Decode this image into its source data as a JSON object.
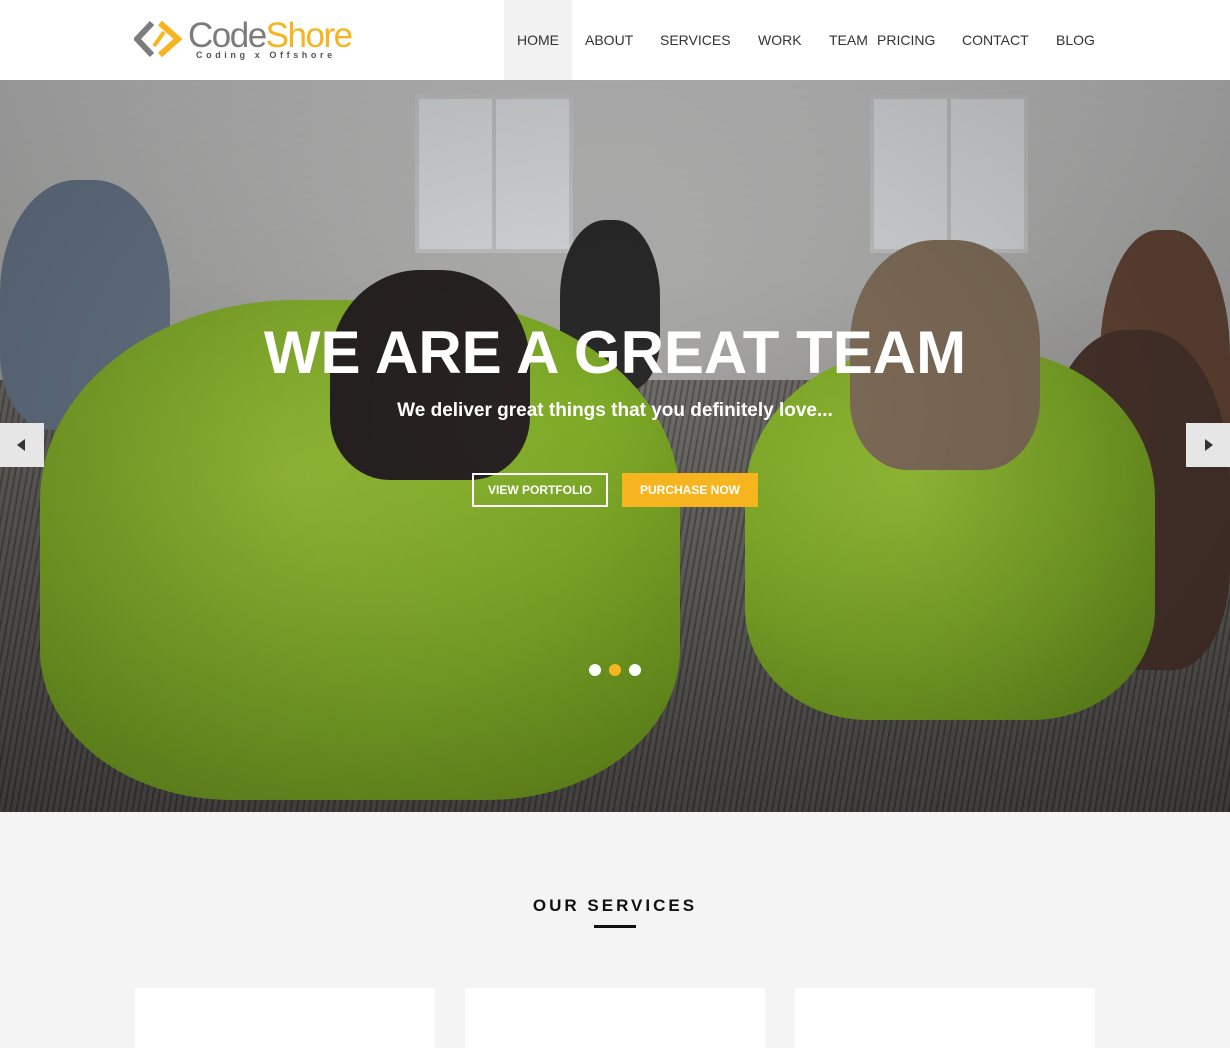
{
  "logo": {
    "word_part1": "Code",
    "word_part2": "Shore",
    "tagline": "Coding x Offshore",
    "icon": "code-brackets-icon"
  },
  "nav": {
    "items": [
      {
        "label": "HOME",
        "active": true
      },
      {
        "label": "ABOUT"
      },
      {
        "label": "SERVICES"
      },
      {
        "label": "WORK"
      },
      {
        "label": "TEAM"
      },
      {
        "label": "PRICING"
      },
      {
        "label": "CONTACT"
      },
      {
        "label": "BLOG"
      }
    ]
  },
  "hero": {
    "title": "WE ARE A GREAT TEAM",
    "subtitle": "We deliver great things that you definitely love...",
    "btn_portfolio": "VIEW PORTFOLIO",
    "btn_purchase": "PURCHASE NOW",
    "prev_icon": "caret-left-icon",
    "next_icon": "caret-right-icon",
    "slide_count": 3,
    "active_slide": 2
  },
  "services": {
    "title": "OUR SERVICES"
  },
  "colors": {
    "accent": "#f6b51e",
    "logo_gray": "#7c7c7c",
    "header_bg": "#ffffff",
    "section_bg": "#f4f4f4"
  }
}
